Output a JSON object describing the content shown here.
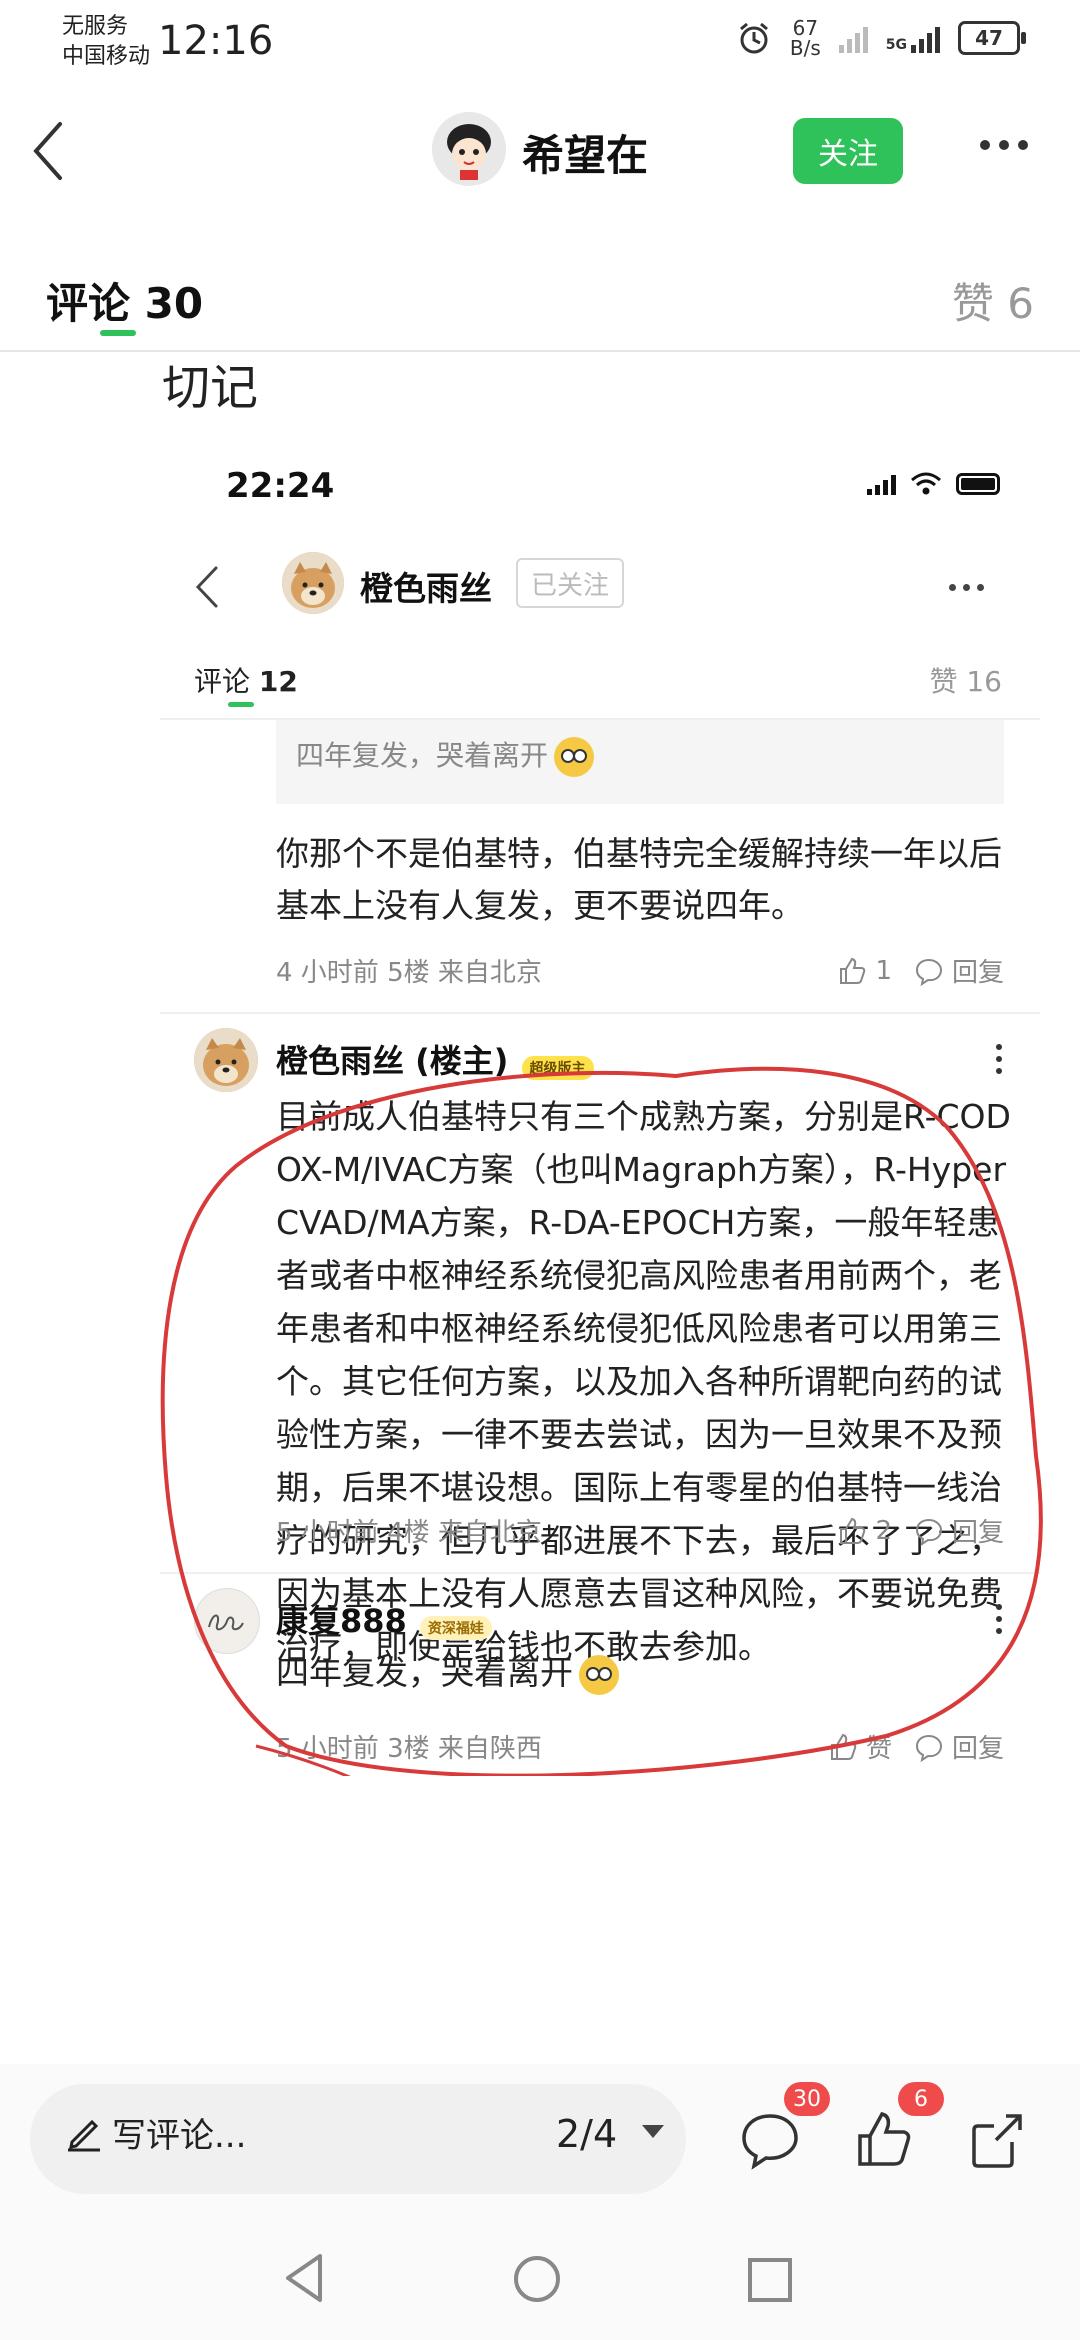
{
  "status_bar": {
    "carrier_line1": "无服务",
    "carrier_line2": "中国移动",
    "time": "12:16",
    "net_speed_value": "67",
    "net_speed_unit": "B/s",
    "signal_tag": "5G",
    "battery": "47"
  },
  "nav": {
    "user_name": "希望在",
    "follow_label": "关注"
  },
  "tabs": {
    "comments_label": "评论",
    "comments_count": "30",
    "likes_label": "赞",
    "likes_count": "6"
  },
  "post_text": "切记",
  "embedded": {
    "time": "22:24",
    "user_name": "橙色雨丝",
    "followed_label": "已关注",
    "comments_label": "评论",
    "comments_count": "12",
    "likes_text": "赞 16",
    "quote_text": "四年复发，哭着离开",
    "reply": {
      "text": "你那个不是伯基特，伯基特完全缓解持续一年以后基本上没有人复发，更不要说四年。",
      "time": "4 小时前",
      "floor": "5楼",
      "location": "来自北京",
      "like_count": "1",
      "reply_label": "回复"
    },
    "main_comment": {
      "author": "橙色雨丝 (楼主)",
      "badge": "超级版主",
      "text": "目前成人伯基特只有三个成熟方案，分别是R-CODOX-M/IVAC方案（也叫Magraph方案），R-HyperCVAD/MA方案，R-DA-EPOCH方案，一般年轻患者或者中枢神经系统侵犯高风险患者用前两个，老年患者和中枢神经系统侵犯低风险患者可以用第三个。其它任何方案，以及加入各种所谓靶向药的试验性方案，一律不要去尝试，因为一旦效果不及预期，后果不堪设想。国际上有零星的伯基特一线治疗的研究，但几乎都进展不下去，最后不了了之，因为基本上没有人愿意去冒这种风险，不要说免费治疗，即使是给钱也不敢去参加。",
      "time": "5 小时前",
      "floor": "4楼",
      "location": "来自北京",
      "like_count": "2",
      "reply_label": "回复"
    },
    "third_comment": {
      "author": "康复888",
      "badge": "资深福娃",
      "text": "四年复发，哭着离开",
      "time": "5 小时前",
      "floor": "3楼",
      "location": "来自陕西",
      "like_label": "赞",
      "reply_label": "回复"
    }
  },
  "bottom_bar": {
    "write_placeholder": "写评论...",
    "page_indicator": "2/4",
    "comment_badge": "30",
    "like_badge": "6"
  },
  "colors": {
    "accent_green": "#2fc25b",
    "badge_red": "#f04b4b",
    "annotation_red": "#d83a3a"
  }
}
